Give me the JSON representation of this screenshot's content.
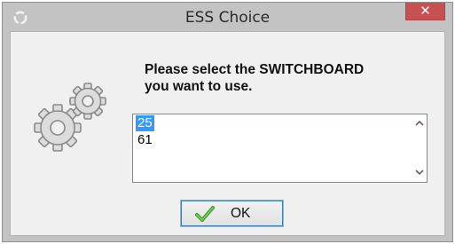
{
  "window": {
    "title": "ESS Choice",
    "close_symbol": "✕",
    "app_icon": "app-icon",
    "close_color": "#c75050"
  },
  "prompt": {
    "line1": "Please select the SWITCHBOARD",
    "line2": "you want to use."
  },
  "list": {
    "items": [
      "25",
      "61"
    ],
    "selected_index": 0,
    "selection_color": "#3399ff",
    "scroll_up_symbol": "⌃",
    "scroll_down_symbol": "⌄"
  },
  "icons": {
    "decoration": "gears-icon",
    "ok": "checkmark-icon"
  },
  "buttons": {
    "ok_label": "OK"
  }
}
